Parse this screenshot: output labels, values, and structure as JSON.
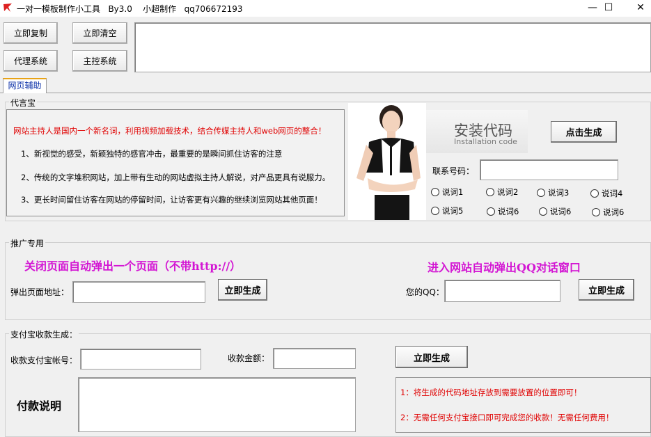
{
  "window": {
    "title": "一对一模板制作小工具   By3.0    小超制作   qq706672193",
    "minimize": "—",
    "maximize": "☐",
    "close": "✕"
  },
  "top_buttons": {
    "copy": "立即复制",
    "clear": "立即清空",
    "proxy": "代理系统",
    "master": "主控系统"
  },
  "tab": {
    "label": "网页辅助"
  },
  "daiyanbao": {
    "group_label": "代言宝",
    "headline": "网站主持人是国内一个新名词，利用视频加载技术，结合传媒主持人和web网页的整合！",
    "line1": "1、新视觉的感受，新颖独特的感官冲击，最重要的是瞬间抓住访客的注意",
    "line2": "2、传统的文字堆积网站，加上带有生动的网站虚拟主持人解说，对产品更具有说服力。",
    "line3": "3、更长时间留住访客在网站的停留时间，让访客更有兴趣的继续浏览网站其他页面！",
    "install_title": "安装代码",
    "install_sub": "Installation code",
    "generate": "点击生成",
    "contact_label": "联系号码：",
    "radios_row1": [
      "说词1",
      "说词2",
      "说词3",
      "说词4"
    ],
    "radios_row2": [
      "说词5",
      "说词6",
      "说词6",
      "说词6"
    ]
  },
  "promo": {
    "group_label": "推广专用",
    "left_title": "关闭页面自动弹出一个页面（不带http://）",
    "left_label": "弹出页面地址：",
    "left_button": "立即生成",
    "right_title": "进入网站自动弹出QQ对话窗口",
    "right_label": "您的QQ：",
    "right_button": "立即生成"
  },
  "alipay": {
    "group_label": "支付宝收款生成：",
    "account_label": "收款支付宝帐号：",
    "amount_label": "收款金额：",
    "button": "立即生成",
    "desc_label": "付款说明",
    "note1": "1：将生成的代码地址存放到需要放置的位置即可！",
    "note2": "2：无需任何支付宝接口即可完成您的收款！无需任何费用！"
  },
  "colors": {
    "magenta": "#d316d3",
    "red": "#e00000",
    "tab_accent": "#e8a317"
  }
}
